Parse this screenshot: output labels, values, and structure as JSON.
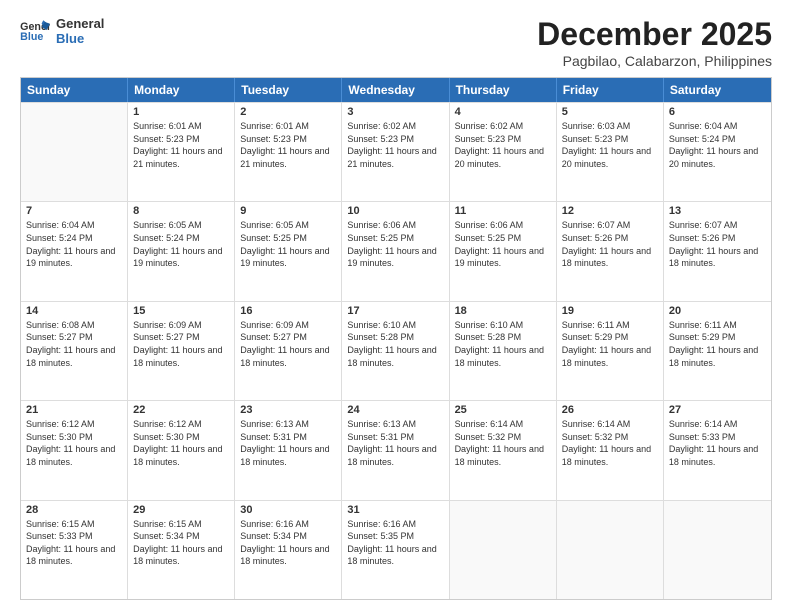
{
  "header": {
    "logo": "GeneralBlue",
    "month": "December 2025",
    "location": "Pagbilao, Calabarzon, Philippines"
  },
  "days": [
    "Sunday",
    "Monday",
    "Tuesday",
    "Wednesday",
    "Thursday",
    "Friday",
    "Saturday"
  ],
  "weeks": [
    [
      {
        "date": "",
        "sunrise": "",
        "sunset": "",
        "daylight": ""
      },
      {
        "date": "1",
        "sunrise": "6:01 AM",
        "sunset": "5:23 PM",
        "daylight": "11 hours and 21 minutes."
      },
      {
        "date": "2",
        "sunrise": "6:01 AM",
        "sunset": "5:23 PM",
        "daylight": "11 hours and 21 minutes."
      },
      {
        "date": "3",
        "sunrise": "6:02 AM",
        "sunset": "5:23 PM",
        "daylight": "11 hours and 21 minutes."
      },
      {
        "date": "4",
        "sunrise": "6:02 AM",
        "sunset": "5:23 PM",
        "daylight": "11 hours and 20 minutes."
      },
      {
        "date": "5",
        "sunrise": "6:03 AM",
        "sunset": "5:23 PM",
        "daylight": "11 hours and 20 minutes."
      },
      {
        "date": "6",
        "sunrise": "6:04 AM",
        "sunset": "5:24 PM",
        "daylight": "11 hours and 20 minutes."
      }
    ],
    [
      {
        "date": "7",
        "sunrise": "6:04 AM",
        "sunset": "5:24 PM",
        "daylight": "11 hours and 19 minutes."
      },
      {
        "date": "8",
        "sunrise": "6:05 AM",
        "sunset": "5:24 PM",
        "daylight": "11 hours and 19 minutes."
      },
      {
        "date": "9",
        "sunrise": "6:05 AM",
        "sunset": "5:25 PM",
        "daylight": "11 hours and 19 minutes."
      },
      {
        "date": "10",
        "sunrise": "6:06 AM",
        "sunset": "5:25 PM",
        "daylight": "11 hours and 19 minutes."
      },
      {
        "date": "11",
        "sunrise": "6:06 AM",
        "sunset": "5:25 PM",
        "daylight": "11 hours and 19 minutes."
      },
      {
        "date": "12",
        "sunrise": "6:07 AM",
        "sunset": "5:26 PM",
        "daylight": "11 hours and 18 minutes."
      },
      {
        "date": "13",
        "sunrise": "6:07 AM",
        "sunset": "5:26 PM",
        "daylight": "11 hours and 18 minutes."
      }
    ],
    [
      {
        "date": "14",
        "sunrise": "6:08 AM",
        "sunset": "5:27 PM",
        "daylight": "11 hours and 18 minutes."
      },
      {
        "date": "15",
        "sunrise": "6:09 AM",
        "sunset": "5:27 PM",
        "daylight": "11 hours and 18 minutes."
      },
      {
        "date": "16",
        "sunrise": "6:09 AM",
        "sunset": "5:27 PM",
        "daylight": "11 hours and 18 minutes."
      },
      {
        "date": "17",
        "sunrise": "6:10 AM",
        "sunset": "5:28 PM",
        "daylight": "11 hours and 18 minutes."
      },
      {
        "date": "18",
        "sunrise": "6:10 AM",
        "sunset": "5:28 PM",
        "daylight": "11 hours and 18 minutes."
      },
      {
        "date": "19",
        "sunrise": "6:11 AM",
        "sunset": "5:29 PM",
        "daylight": "11 hours and 18 minutes."
      },
      {
        "date": "20",
        "sunrise": "6:11 AM",
        "sunset": "5:29 PM",
        "daylight": "11 hours and 18 minutes."
      }
    ],
    [
      {
        "date": "21",
        "sunrise": "6:12 AM",
        "sunset": "5:30 PM",
        "daylight": "11 hours and 18 minutes."
      },
      {
        "date": "22",
        "sunrise": "6:12 AM",
        "sunset": "5:30 PM",
        "daylight": "11 hours and 18 minutes."
      },
      {
        "date": "23",
        "sunrise": "6:13 AM",
        "sunset": "5:31 PM",
        "daylight": "11 hours and 18 minutes."
      },
      {
        "date": "24",
        "sunrise": "6:13 AM",
        "sunset": "5:31 PM",
        "daylight": "11 hours and 18 minutes."
      },
      {
        "date": "25",
        "sunrise": "6:14 AM",
        "sunset": "5:32 PM",
        "daylight": "11 hours and 18 minutes."
      },
      {
        "date": "26",
        "sunrise": "6:14 AM",
        "sunset": "5:32 PM",
        "daylight": "11 hours and 18 minutes."
      },
      {
        "date": "27",
        "sunrise": "6:14 AM",
        "sunset": "5:33 PM",
        "daylight": "11 hours and 18 minutes."
      }
    ],
    [
      {
        "date": "28",
        "sunrise": "6:15 AM",
        "sunset": "5:33 PM",
        "daylight": "11 hours and 18 minutes."
      },
      {
        "date": "29",
        "sunrise": "6:15 AM",
        "sunset": "5:34 PM",
        "daylight": "11 hours and 18 minutes."
      },
      {
        "date": "30",
        "sunrise": "6:16 AM",
        "sunset": "5:34 PM",
        "daylight": "11 hours and 18 minutes."
      },
      {
        "date": "31",
        "sunrise": "6:16 AM",
        "sunset": "5:35 PM",
        "daylight": "11 hours and 18 minutes."
      },
      {
        "date": "",
        "sunrise": "",
        "sunset": "",
        "daylight": ""
      },
      {
        "date": "",
        "sunrise": "",
        "sunset": "",
        "daylight": ""
      },
      {
        "date": "",
        "sunrise": "",
        "sunset": "",
        "daylight": ""
      }
    ]
  ]
}
